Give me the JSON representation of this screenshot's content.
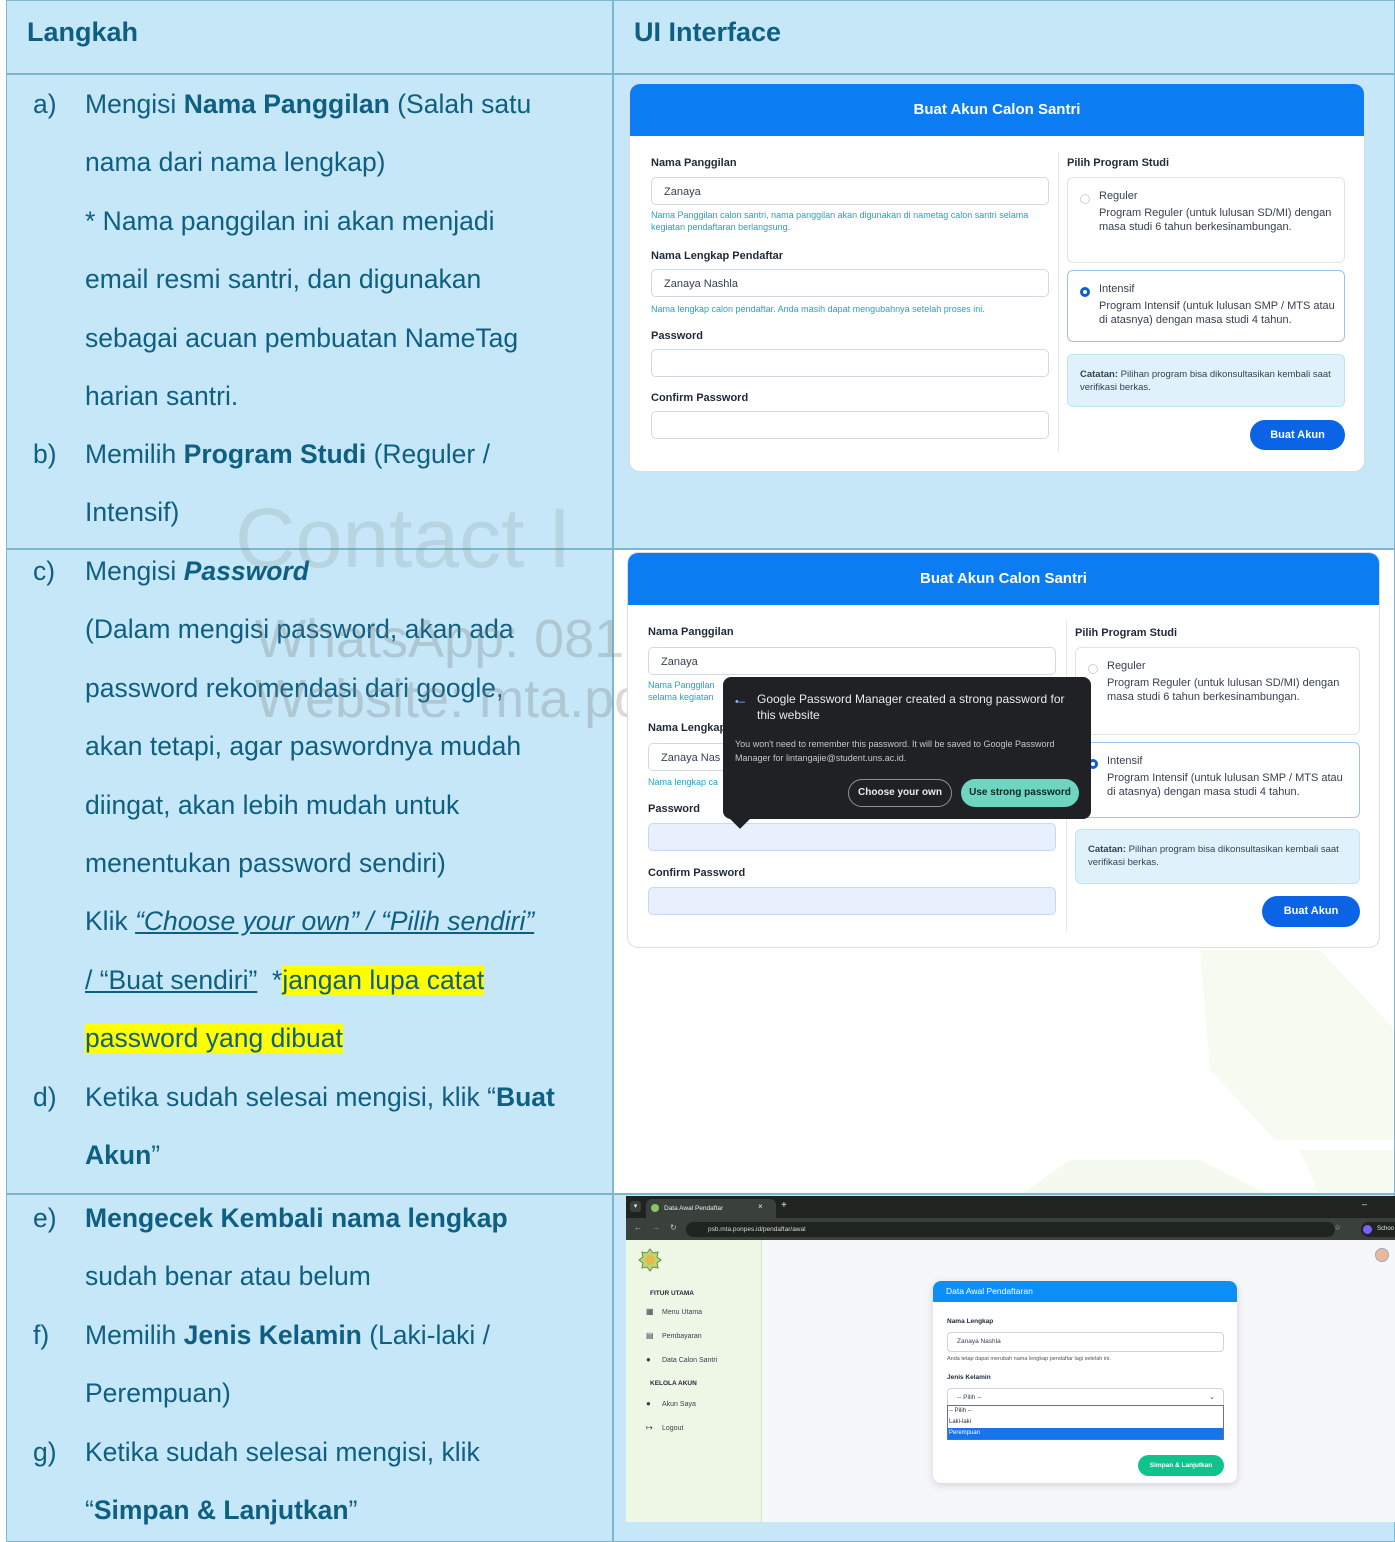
{
  "header": {
    "col_left": "Langkah",
    "col_right": "UI Interface"
  },
  "watermark": {
    "line1": "Contact I",
    "line2": "WhatsApp: 081",
    "line3": "Website: mta.po"
  },
  "steps": {
    "a": {
      "letter": "a)",
      "l1_pre": "Mengisi ",
      "l1_bold": "Nama Panggilan",
      "l1_post": " (Salah satu",
      "l2": "nama dari nama lengkap)",
      "l3": "* Nama panggilan ini akan menjadi",
      "l4": "email resmi santri, dan digunakan",
      "l5": "sebagai acuan pembuatan NameTag",
      "l6": "harian santri."
    },
    "b": {
      "letter": "b)",
      "l1_pre": "Memilih ",
      "l1_bold": "Program Studi",
      "l1_post": " (Reguler /",
      "l2": "Intensif)"
    },
    "c": {
      "letter": "c)",
      "l1_pre": "Mengisi ",
      "l1_bold": "Password",
      "l2": "(Dalam mengisi password, akan ada",
      "l3": "password rekomendasi dari google,",
      "l4": "akan tetapi, agar paswordnya mudah",
      "l5": "diingat, akan lebih mudah untuk",
      "l6": "menentukan password sendiri)",
      "l7_pre": "Klik ",
      "l7_link": "“Choose your own” / “Pilih sendiri”",
      "l8_link": "/ “Buat sendiri”",
      "l8_mid": "  *",
      "l8_hl": "jangan lupa catat",
      "l9_hl": "password yang dibuat"
    },
    "d": {
      "letter": "d)",
      "l1_pre": "Ketika sudah selesai mengisi, klik “",
      "l1_bold": "Buat",
      "l2_bold": "Akun",
      "l2_post": "”"
    },
    "e": {
      "letter": "e)",
      "l1_bold": "Mengecek Kembali nama lengkap",
      "l2": "sudah benar atau belum"
    },
    "f": {
      "letter": "f)",
      "l1_pre": "Memilih ",
      "l1_bold": "Jenis Kelamin",
      "l1_post": " (Laki-laki /",
      "l2": "Perempuan)"
    },
    "g": {
      "letter": "g)",
      "l1": "Ketika sudah selesai mengisi, klik",
      "l2_pre": "“",
      "l2_bold": "Simpan & Lanjutkan",
      "l2_post": "”"
    }
  },
  "screen1": {
    "title": "Buat Akun Calon Santri",
    "nick_label": "Nama Panggilan",
    "nick_value": "Zanaya",
    "nick_hint": "Nama Panggilan calon santri, nama panggilan akan digunakan di nametag calon santri selama kegiatan pendaftaran berlangsung.",
    "full_label": "Nama Lengkap Pendaftar",
    "full_value": "Zanaya Nashla",
    "full_hint": "Nama lengkap calon pendaftar. Anda masih dapat mengubahnya setelah proses ini.",
    "pass_label": "Password",
    "confirm_label": "Confirm Password",
    "program_label": "Pilih Program Studi",
    "reguler_title": "Reguler",
    "reguler_desc": "Program Reguler (untuk lulusan SD/MI) dengan masa studi 6 tahun berkesinambungan.",
    "intensif_title": "Intensif",
    "intensif_desc": "Program Intensif (untuk lulusan SMP / MTS atau di atasnya) dengan masa studi 4 tahun.",
    "note_bold": "Catatan:",
    "note_text": " Pilihan program bisa dikonsultasikan kembali saat verifikasi berkas.",
    "button": "Buat Akun"
  },
  "screen2": {
    "title": "Buat Akun Calon Santri",
    "nick_label": "Nama Panggilan",
    "nick_value": "Zanaya",
    "nick_hint_1": "Nama Panggilan",
    "nick_hint_2": "selama kegiatan",
    "full_label": "Nama Lengkap",
    "full_value": "Zanaya Nas",
    "full_hint": "Nama lengkap ca",
    "pass_label": "Password",
    "confirm_label": "Confirm Password",
    "program_label": "Pilih Program Studi",
    "reguler_title": "Reguler",
    "reguler_desc": "Program Reguler (untuk lulusan SD/MI) dengan masa studi 6 tahun berkesinambungan.",
    "intensif_title": "Intensif",
    "intensif_desc": "Program Intensif (untuk lulusan SMP / MTS atau di atasnya) dengan masa studi 4 tahun.",
    "note_bold": "Catatan:",
    "note_text": " Pilihan program bisa dikonsultasikan kembali saat verifikasi berkas.",
    "button": "Buat Akun",
    "gpm_title": "Google Password Manager created a strong password for this website",
    "gpm_body": "You won't need to remember this password. It will be saved to Google Password Manager for lintangajie@student.uns.ac.id.",
    "gpm_choose": "Choose your own",
    "gpm_use": "Use strong password"
  },
  "screen3": {
    "tab_title": "Data Awal Pendaftar",
    "url": "psb.mta.ponpes.id/pendaftar/awal",
    "profile_btn": "Schoo",
    "sec_main": "FITUR UTAMA",
    "nav_menu": "Menu Utama",
    "nav_pay": "Pembayaran",
    "nav_data": "Data Calon Santri",
    "sec_account": "KELOLA AKUN",
    "nav_account": "Akun Saya",
    "nav_logout": "Logout",
    "form_title": "Data Awal Pendaftaran",
    "name_label": "Nama Lengkap",
    "name_value": "Zanaya Nashla",
    "name_hint": "Anda tetap dapat merubah nama lengkap pendaftar lagi setelah ini.",
    "gender_label": "Jenis Kelamin",
    "gender_selected": "-- Pilih --",
    "gender_options": [
      "-- Pilih --",
      "Laki-laki",
      "Perempuan"
    ],
    "save_button": "Simpan & Lanjutkan"
  },
  "colors": {
    "table_bg": "#c5e7f7",
    "text": "#0f5f82",
    "header_blue": "#0b7cf2",
    "highlight": "#ffff00"
  }
}
